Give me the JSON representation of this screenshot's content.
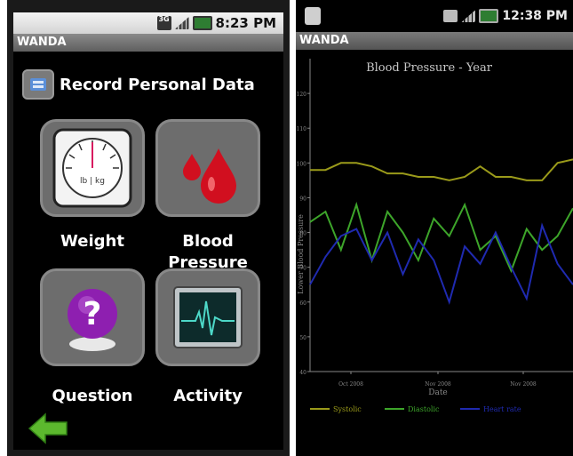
{
  "left": {
    "status": {
      "network": "3G",
      "time": "8:23 PM"
    },
    "app_title": "WANDA",
    "header": {
      "title": "Record Personal Data"
    },
    "tiles": [
      {
        "label": "Weight",
        "icon": "scale-icon",
        "dial_text": "lb | kg"
      },
      {
        "label_line1": "Blood",
        "label_line2": "Pressure",
        "icon": "blood-drop-icon"
      },
      {
        "label": "Question",
        "icon": "question-icon"
      },
      {
        "label": "Activity",
        "icon": "heart-monitor-icon"
      }
    ],
    "back": {
      "icon": "back-arrow-icon"
    }
  },
  "right": {
    "status": {
      "time": "12:38 PM"
    },
    "app_title": "WANDA",
    "chart_data": {
      "type": "line",
      "title": "Blood Pressure - Year",
      "xlabel": "Date",
      "ylabel": "Lower Blood Pressure",
      "x": [
        "Oct 2008",
        "Nov 2008",
        "Nov 2008"
      ],
      "y_ticks": [
        "120",
        "110",
        "100",
        "90",
        "80",
        "70",
        "60",
        "50",
        "40"
      ],
      "ylim": [
        40,
        130
      ],
      "series": [
        {
          "name": "Systolic",
          "color": "#9a9a1a",
          "values": [
            98,
            98,
            100,
            100,
            99,
            97,
            97,
            96,
            96,
            95,
            96,
            99,
            96,
            96,
            95,
            95,
            100,
            101
          ]
        },
        {
          "name": "Diastolic",
          "color": "#3da52a",
          "values": [
            83,
            86,
            75,
            88,
            72,
            86,
            80,
            72,
            84,
            79,
            88,
            75,
            79,
            69,
            81,
            75,
            79,
            87
          ]
        },
        {
          "name": "Heart rate",
          "color": "#1f2ab0",
          "values": [
            65,
            73,
            79,
            81,
            72,
            80,
            68,
            78,
            72,
            60,
            76,
            71,
            80,
            70,
            61,
            82,
            71,
            65
          ]
        }
      ],
      "grid": false,
      "legend": "bottom"
    }
  },
  "colors": {
    "tile_bg": "#6d6d6d",
    "systolic": "#9a9a1a",
    "diastolic": "#3da52a",
    "heart_rate": "#1f2ab0"
  }
}
